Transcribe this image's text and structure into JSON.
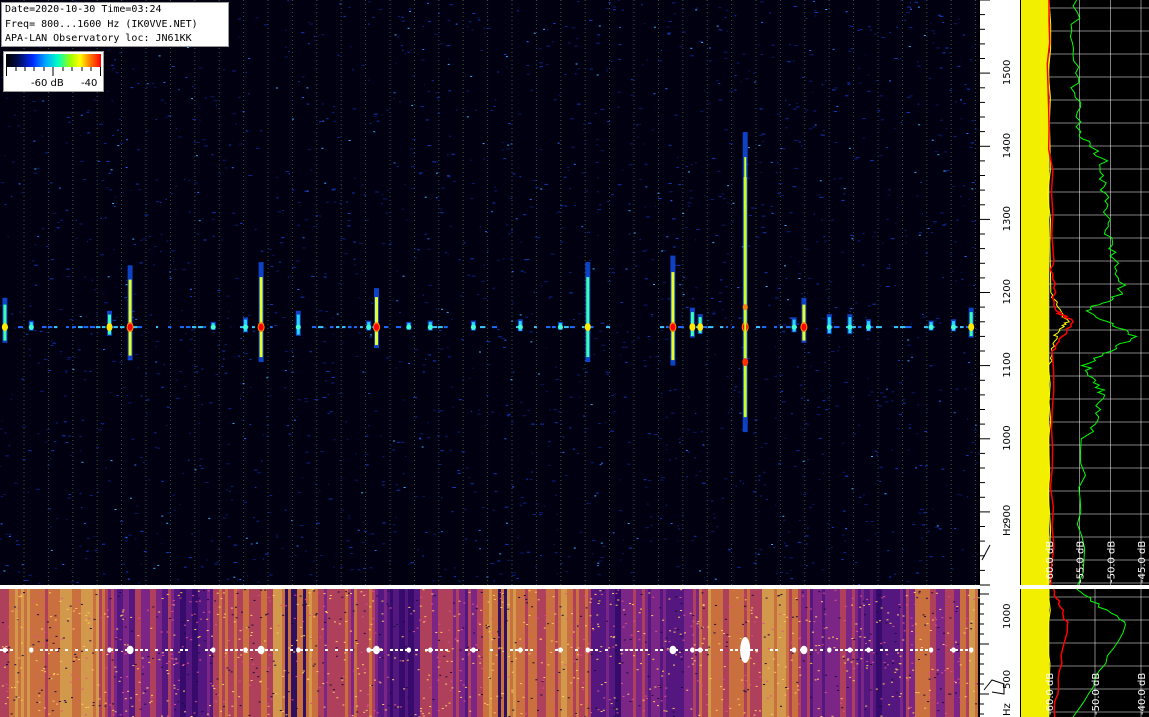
{
  "info": {
    "line1": "Date=2020-10-30 Time=03:24",
    "line2": "Freq= 800...1600 Hz (IK0VVE.NET)",
    "line3": "APA-LAN Observatory loc: JN61KK"
  },
  "colorbar": {
    "low_label": "-60 dB",
    "high_label": "-40"
  },
  "colors": {
    "background": "#000010",
    "signal_hot": "#ff0000",
    "signal_warm": "#ffff00",
    "signal_cool": "#00c8ff",
    "spectrum_avg": "#ffff00",
    "spectrum_peak": "#00ff00",
    "spectrum_mean": "#ff0000"
  },
  "chart_data": [
    {
      "type": "heatmap",
      "title": "",
      "xlabel": "",
      "ylabel": "Hz",
      "ylim": [
        800,
        1600
      ],
      "y_ticks": [
        "900",
        "1000",
        "1100",
        "1200",
        "1300",
        "1400",
        "1500"
      ],
      "y_unit_label": "Hz",
      "signal_frequency_hz": 1150,
      "pulses": [
        {
          "t": 0.005,
          "len": 45,
          "v": "mid"
        },
        {
          "t": 0.032,
          "len": 10,
          "v": "low"
        },
        {
          "t": 0.112,
          "len": 25,
          "v": "mid"
        },
        {
          "t": 0.133,
          "len": 95,
          "v": "high"
        },
        {
          "t": 0.218,
          "len": 8,
          "v": "low"
        },
        {
          "t": 0.251,
          "len": 15,
          "v": "low"
        },
        {
          "t": 0.267,
          "len": 100,
          "v": "high"
        },
        {
          "t": 0.305,
          "len": 25,
          "v": "low"
        },
        {
          "t": 0.377,
          "len": 10,
          "v": "low"
        },
        {
          "t": 0.385,
          "len": 60,
          "v": "high"
        },
        {
          "t": 0.418,
          "len": 8,
          "v": "low"
        },
        {
          "t": 0.44,
          "len": 10,
          "v": "low"
        },
        {
          "t": 0.484,
          "len": 10,
          "v": "low"
        },
        {
          "t": 0.532,
          "len": 12,
          "v": "low"
        },
        {
          "t": 0.573,
          "len": 8,
          "v": "low"
        },
        {
          "t": 0.601,
          "len": 100,
          "v": "mid"
        },
        {
          "t": 0.688,
          "len": 110,
          "v": "high"
        },
        {
          "t": 0.708,
          "len": 30,
          "v": "mid"
        },
        {
          "t": 0.716,
          "len": 20,
          "v": "mid"
        },
        {
          "t": 0.762,
          "len": 300,
          "v": "high"
        },
        {
          "t": 0.812,
          "len": 15,
          "v": "low"
        },
        {
          "t": 0.822,
          "len": 45,
          "v": "high"
        },
        {
          "t": 0.848,
          "len": 20,
          "v": "low"
        },
        {
          "t": 0.869,
          "len": 20,
          "v": "low"
        },
        {
          "t": 0.888,
          "len": 12,
          "v": "low"
        },
        {
          "t": 0.952,
          "len": 10,
          "v": "low"
        },
        {
          "t": 0.975,
          "len": 12,
          "v": "low"
        },
        {
          "t": 0.993,
          "len": 30,
          "v": "mid"
        }
      ]
    },
    {
      "type": "line",
      "title": "",
      "x_ticks": [
        "-60.0 dB",
        "-55.0 dB",
        "-50.0 dB",
        "-45.0 dB"
      ],
      "ylim": [
        800,
        1600
      ],
      "series": [
        {
          "color": "#ffff00",
          "points_hz_db": [
            [
              800,
              -60
            ],
            [
              1100,
              -60
            ],
            [
              1140,
              -59
            ],
            [
              1160,
              -57
            ],
            [
              1200,
              -60
            ],
            [
              1600,
              -60
            ]
          ]
        },
        {
          "color": "#ff0000",
          "points_hz_db": [
            [
              800,
              -59.5
            ],
            [
              1120,
              -59.5
            ],
            [
              1160,
              -56
            ],
            [
              1175,
              -59
            ],
            [
              1250,
              -59.6
            ],
            [
              1600,
              -60
            ]
          ]
        },
        {
          "color": "#00ff00",
          "points_hz_db": [
            [
              800,
              -55
            ],
            [
              1000,
              -54
            ],
            [
              1060,
              -51
            ],
            [
              1100,
              -54
            ],
            [
              1140,
              -46
            ],
            [
              1175,
              -54
            ],
            [
              1200,
              -48
            ],
            [
              1260,
              -50
            ],
            [
              1320,
              -51
            ],
            [
              1380,
              -51
            ],
            [
              1420,
              -55
            ],
            [
              1500,
              -56
            ],
            [
              1600,
              -55.5
            ]
          ]
        }
      ]
    },
    {
      "type": "heatmap",
      "title": "",
      "ylabel": "Hz",
      "y_ticks": [
        "500",
        "1000"
      ],
      "y_unit_label": "Hz"
    },
    {
      "type": "line",
      "title": "",
      "x_ticks": [
        "-60.0 dB",
        "-50.0 dB",
        "-40.0 dB"
      ],
      "series": [
        {
          "color": "#ffff00",
          "points_hz_db": [
            [
              0,
              -60
            ],
            [
              1600,
              -60
            ]
          ]
        },
        {
          "color": "#ff0000",
          "points_hz_db": [
            [
              0,
              -59
            ],
            [
              1150,
              -56
            ],
            [
              1600,
              -59
            ]
          ]
        },
        {
          "color": "#00ff00",
          "points_hz_db": [
            [
              0,
              -54
            ],
            [
              1150,
              -43
            ],
            [
              1600,
              -54
            ]
          ]
        }
      ]
    }
  ]
}
